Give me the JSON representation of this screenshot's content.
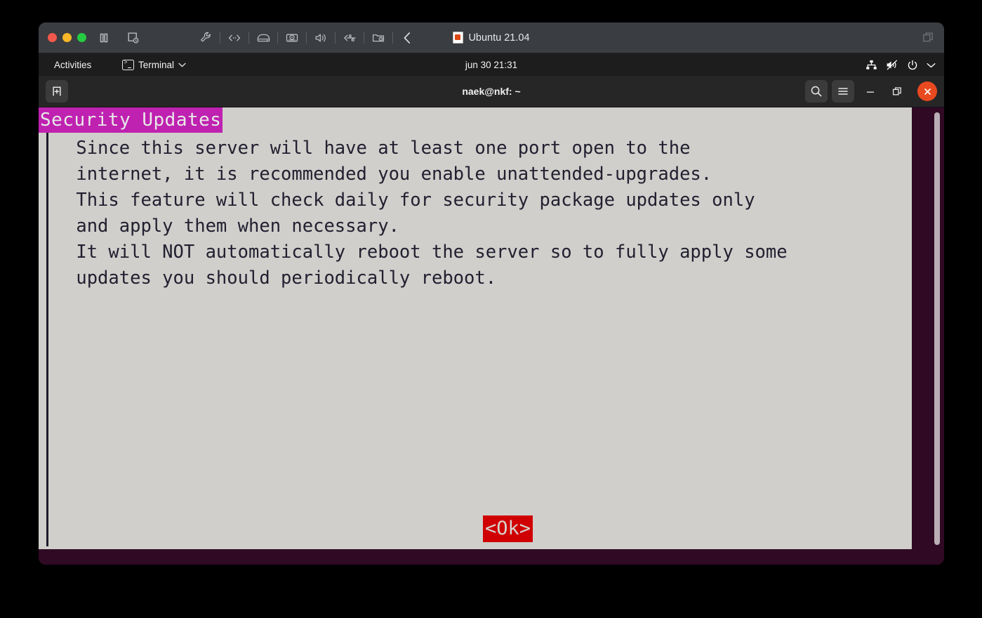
{
  "vm_window": {
    "title": "Ubuntu 21.04",
    "title_icon": "ubuntu-document-icon",
    "traffic_lights": [
      {
        "name": "close",
        "color": "#f2584b"
      },
      {
        "name": "minimize",
        "color": "#f9b728"
      },
      {
        "name": "maximize",
        "color": "#26cb41"
      }
    ],
    "toolbar_left": [
      {
        "name": "pause-icon",
        "label": "Pause"
      },
      {
        "name": "screenshot-icon",
        "label": "Take Screenshot"
      }
    ],
    "toolbar_mid": [
      {
        "name": "settings-wrench-icon",
        "label": "Settings"
      },
      {
        "name": "network-icon",
        "label": "Network"
      },
      {
        "name": "hard-disk-icon",
        "label": "Hard Disks"
      },
      {
        "name": "optical-drive-icon",
        "label": "Optical Drives"
      },
      {
        "name": "audio-icon",
        "label": "Audio"
      },
      {
        "name": "usb-icon",
        "label": "USB Devices"
      },
      {
        "name": "shared-folders-icon",
        "label": "Shared Folders"
      },
      {
        "name": "collapse-chevron-icon",
        "label": "Collapse"
      }
    ],
    "restore_button": "restore-window-icon"
  },
  "gnome_topbar": {
    "activities": "Activities",
    "app_menu": "Terminal",
    "app_menu_icon": "terminal-icon",
    "app_menu_chevron": "chevron-down-icon",
    "clock": "jun 30  21:31",
    "status_icons": [
      {
        "name": "network-wired-icon"
      },
      {
        "name": "volume-muted-icon"
      },
      {
        "name": "power-icon"
      },
      {
        "name": "chevron-down-icon"
      }
    ]
  },
  "terminal": {
    "new_tab_button": "new-tab-icon",
    "title": "naek@nkf: ~",
    "search_button": "search-icon",
    "menu_button": "hamburger-menu-icon",
    "minimize_button": "minimize-icon",
    "restore_button": "restore-icon",
    "close_button": "close-icon",
    "background_color": "#300a24"
  },
  "dialog": {
    "banner_title": "Security Updates",
    "banner_bg": "#bf21b0",
    "banner_fg": "#e8e8e8",
    "body_bg": "#d0cfcb",
    "body_fg": "#222030",
    "body_lines": [
      " Since this server will have at least one port open to the",
      " internet, it is recommended you enable unattended-upgrades.",
      " This feature will check daily for security package updates only",
      " and apply them when necessary.",
      " It will NOT automatically reboot the server so to fully apply some",
      " updates you should periodically reboot."
    ],
    "body_text": " Since this server will have at least one port open to the\n internet, it is recommended you enable unattended-upgrades.\n This feature will check daily for security package updates only\n and apply them when necessary.\n It will NOT automatically reboot the server so to fully apply some\n updates you should periodically reboot.",
    "ok_button": "<Ok>",
    "ok_button_bg": "#d00000",
    "ok_button_fg": "#d6d3cf"
  },
  "scrollbar": {
    "name": "terminal-scrollbar",
    "thumb_color": "#b9aeb5"
  }
}
